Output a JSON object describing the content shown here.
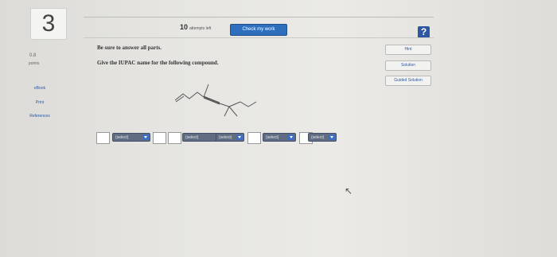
{
  "question": {
    "number": "3",
    "points_value": "0.8",
    "points_label": "points"
  },
  "sidebar": {
    "ebook": "eBook",
    "print": "Print",
    "references": "References"
  },
  "header": {
    "attempts_count": "10",
    "attempts_label": "attempts left",
    "check_button": "Check my work",
    "help_icon": "?"
  },
  "instructions": {
    "line1": "Be sure to answer all parts.",
    "line2": "Give the IUPAC name for the following compound."
  },
  "right_buttons": {
    "hint": "Hint",
    "solution": "Solution",
    "guided_solution": "Guided Solution"
  },
  "answer_selects": [
    {
      "value": "(select)"
    },
    {
      "value": "(select)"
    },
    {
      "value": "(select)"
    },
    {
      "value": "(select)"
    },
    {
      "value": "(select)"
    }
  ]
}
